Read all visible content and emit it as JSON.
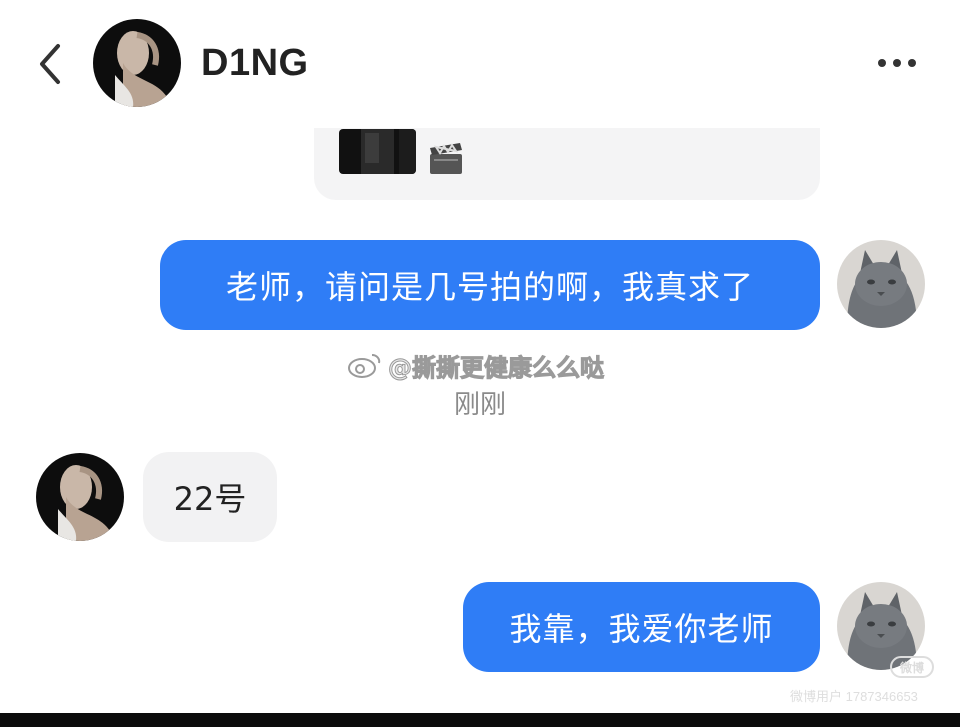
{
  "header": {
    "contact_name": "D1NG",
    "back_icon": "chevron-left-icon",
    "more_icon": "more-horizontal-icon"
  },
  "card": {
    "thumbnail_icon": "video-thumbnail",
    "badge_icon": "clapperboard-icon"
  },
  "messages": [
    {
      "sender": "me",
      "text": "老师，请问是几号拍的啊，我真求了"
    },
    {
      "sender": "them",
      "text": "22号"
    },
    {
      "sender": "me",
      "text": "我靠，我爱你老师"
    }
  ],
  "watermark": {
    "text": "@撕撕更健康么么哒"
  },
  "time_label": "刚刚",
  "corner": {
    "logo": "微博",
    "id_text": "微博用户 1787346653"
  },
  "colors": {
    "my_bubble": "#2f7df6",
    "their_bubble": "#f2f2f3",
    "background": "#ffffff"
  }
}
